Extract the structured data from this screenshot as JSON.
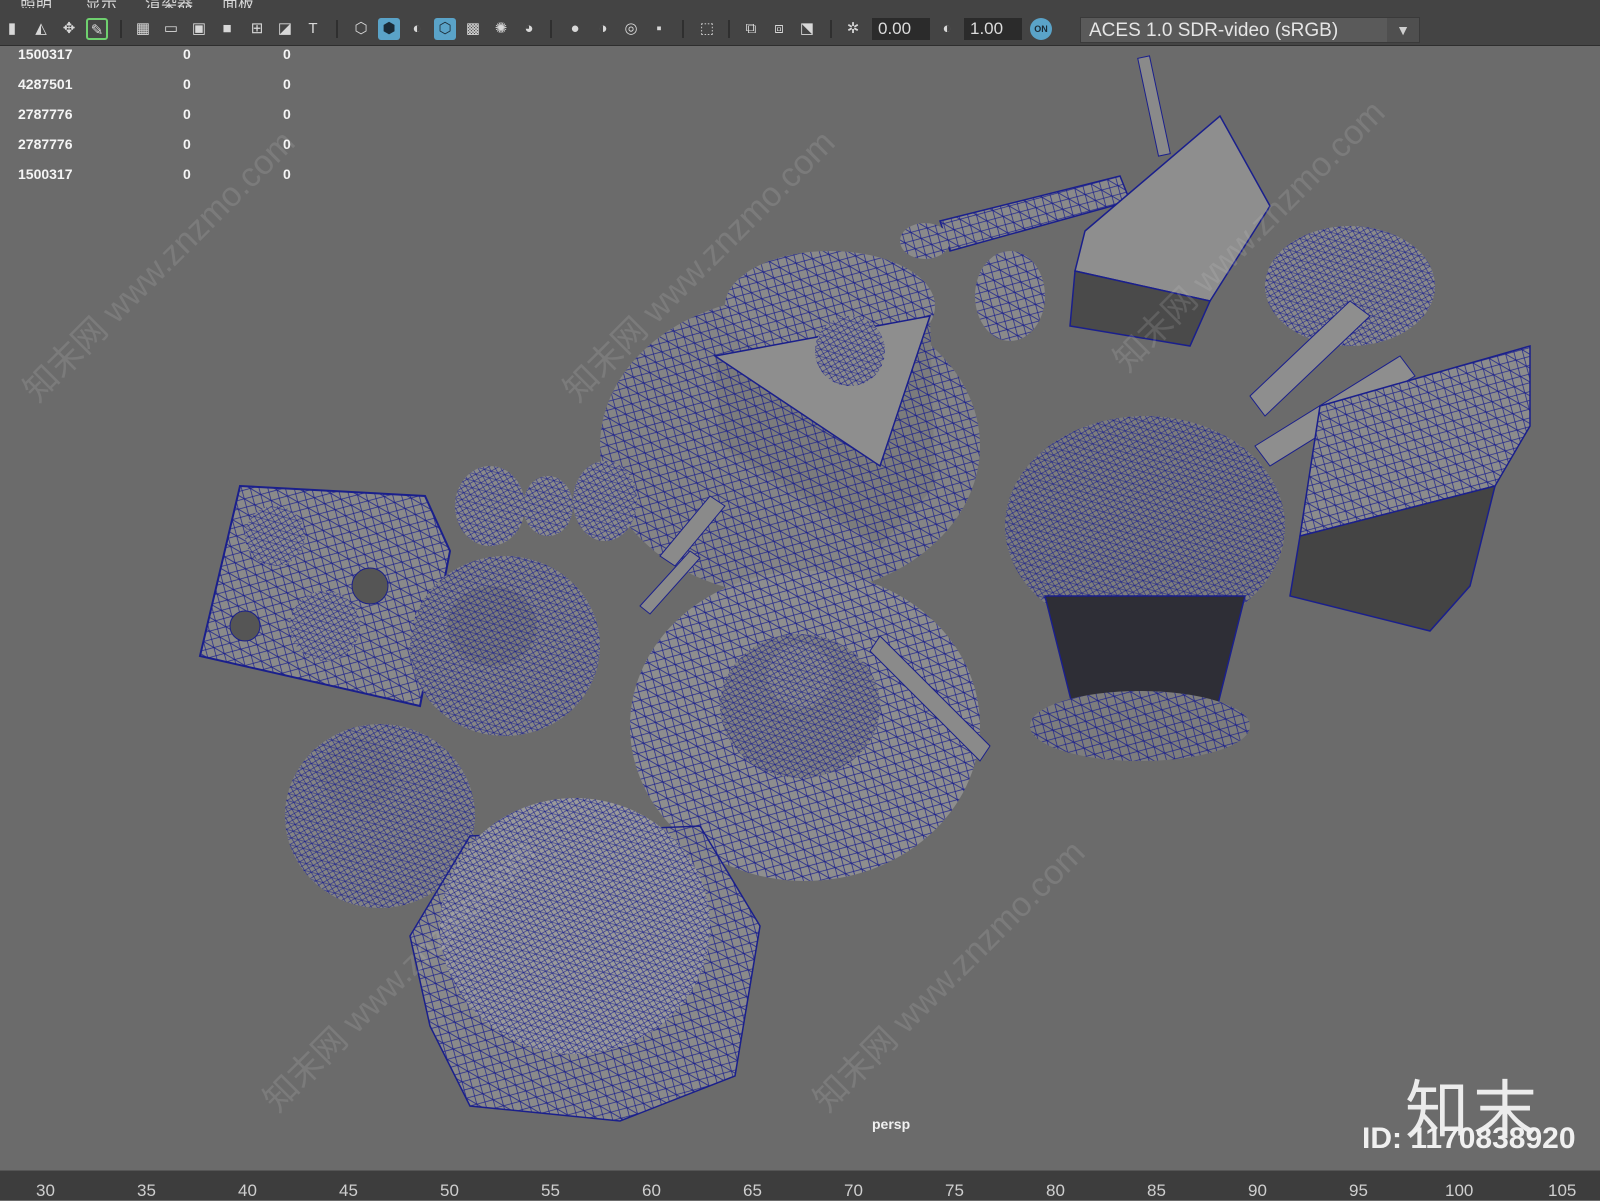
{
  "menu": {
    "items": [
      "照明",
      "显示",
      "渲染器",
      "面板"
    ]
  },
  "toolbar": {
    "icons": [
      "bookmark-icon",
      "camera-icon",
      "camera-tools-icon",
      "pencil-icon",
      "grid-icon",
      "film-gate-icon",
      "resolution-gate-icon",
      "gate-mask-icon",
      "field-chart-icon",
      "safe-action-icon",
      "safe-title-icon",
      "wireframe-icon",
      "smooth-shade-icon",
      "flat-shade-icon",
      "wireframe-on-shaded-icon",
      "xray-icon",
      "lights-icon",
      "shadows-icon",
      "screen-space-ao-icon",
      "motion-blur-icon",
      "multisample-icon",
      "depth-of-field-icon",
      "isolate-select-icon",
      "xray-joints-icon",
      "xray-active-icon",
      "backface-icon",
      "exposure-icon",
      "gamma-icon",
      "color-management-icon"
    ],
    "exposure_value": "0.00",
    "gamma_value": "1.00",
    "colour_management_badge": "ON",
    "view_transform": "ACES 1.0 SDR-video (sRGB)"
  },
  "hud": {
    "rows": [
      [
        "1500317",
        "0",
        "0"
      ],
      [
        "4287501",
        "0",
        "0"
      ],
      [
        "2787776",
        "0",
        "0"
      ],
      [
        "2787776",
        "0",
        "0"
      ],
      [
        "1500317",
        "0",
        "0"
      ]
    ]
  },
  "viewport": {
    "camera": "persp",
    "wire_color": "#1a1f8c",
    "shade_color": "#8d8d8d",
    "background": "#6b6b6b"
  },
  "watermark": {
    "text": "知末网 www.znzmo.com",
    "logo": "知末",
    "id_label": "ID: 1170838920"
  },
  "timeline": {
    "ticks": [
      "30",
      "35",
      "40",
      "45",
      "50",
      "55",
      "60",
      "65",
      "70",
      "75",
      "80",
      "85",
      "90",
      "95",
      "100",
      "105"
    ]
  }
}
